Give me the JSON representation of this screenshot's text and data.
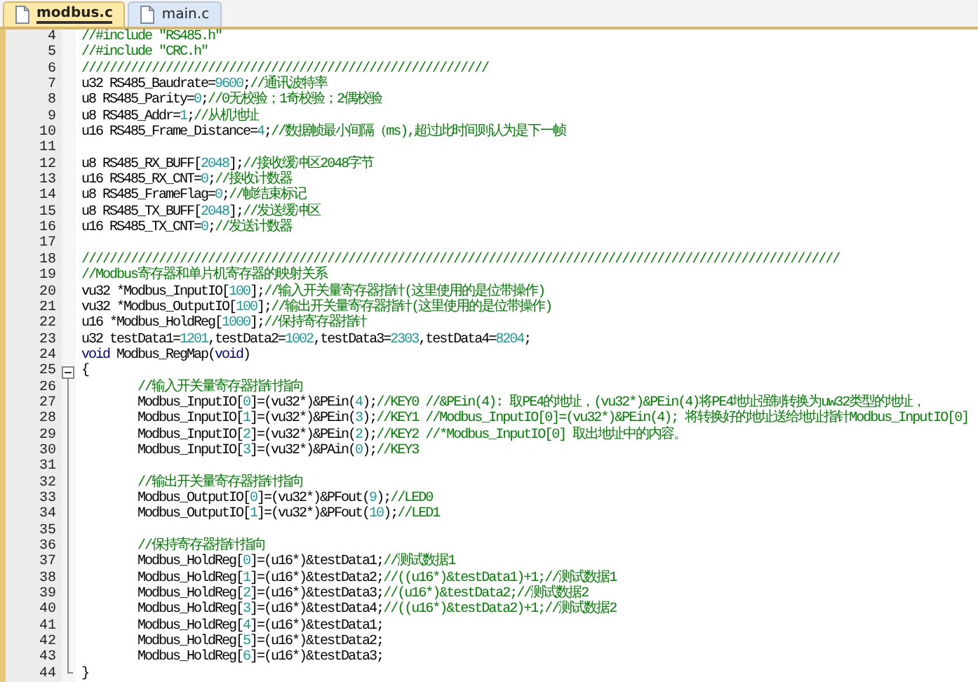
{
  "tabs": [
    {
      "label": "modbus.c",
      "selected": true
    },
    {
      "label": "main.c",
      "selected": false
    }
  ],
  "lines": [
    {
      "number": "4",
      "segments": [
        {
          "kind": "comment",
          "text": "//#include \"RS485.h\""
        }
      ]
    },
    {
      "number": "5",
      "segments": [
        {
          "kind": "comment",
          "text": "//#include \"CRC.h\""
        }
      ]
    },
    {
      "number": "6",
      "segments": [
        {
          "kind": "comment",
          "text": "//////////////////////////////////////////////////////////"
        }
      ]
    },
    {
      "number": "7",
      "segments": [
        {
          "kind": "code",
          "text": "u32 RS485_Baudrate="
        },
        {
          "kind": "number",
          "text": "9600"
        },
        {
          "kind": "code",
          "text": ";"
        },
        {
          "kind": "comment",
          "text": "//通讯波特率"
        }
      ]
    },
    {
      "number": "8",
      "segments": [
        {
          "kind": "code",
          "text": "u8 RS485_Parity="
        },
        {
          "kind": "number",
          "text": "0"
        },
        {
          "kind": "code",
          "text": ";"
        },
        {
          "kind": "comment",
          "text": "//0无校验；1奇校验；2偶校验"
        }
      ]
    },
    {
      "number": "9",
      "segments": [
        {
          "kind": "code",
          "text": "u8 RS485_Addr="
        },
        {
          "kind": "number",
          "text": "1"
        },
        {
          "kind": "code",
          "text": ";"
        },
        {
          "kind": "comment",
          "text": "//从机地址"
        }
      ]
    },
    {
      "number": "10",
      "segments": [
        {
          "kind": "code",
          "text": "u16 RS485_Frame_Distance="
        },
        {
          "kind": "number",
          "text": "4"
        },
        {
          "kind": "code",
          "text": ";"
        },
        {
          "kind": "comment",
          "text": "//数据帧最小间隔（ms),超过此时间则认为是下一帧"
        }
      ]
    },
    {
      "number": "11"
    },
    {
      "number": "12",
      "segments": [
        {
          "kind": "code",
          "text": "u8 RS485_RX_BUFF["
        },
        {
          "kind": "number",
          "text": "2048"
        },
        {
          "kind": "code",
          "text": "];"
        },
        {
          "kind": "comment",
          "text": "//接收缓冲区2048字节"
        }
      ]
    },
    {
      "number": "13",
      "segments": [
        {
          "kind": "code",
          "text": "u16 RS485_RX_CNT="
        },
        {
          "kind": "number",
          "text": "0"
        },
        {
          "kind": "code",
          "text": ";"
        },
        {
          "kind": "comment",
          "text": "//接收计数器"
        }
      ]
    },
    {
      "number": "14",
      "segments": [
        {
          "kind": "code",
          "text": "u8 RS485_FrameFlag="
        },
        {
          "kind": "number",
          "text": "0"
        },
        {
          "kind": "code",
          "text": ";"
        },
        {
          "kind": "comment",
          "text": "//帧结束标记"
        }
      ]
    },
    {
      "number": "15",
      "segments": [
        {
          "kind": "code",
          "text": "u8 RS485_TX_BUFF["
        },
        {
          "kind": "number",
          "text": "2048"
        },
        {
          "kind": "code",
          "text": "];"
        },
        {
          "kind": "comment",
          "text": "//发送缓冲区"
        }
      ]
    },
    {
      "number": "16",
      "segments": [
        {
          "kind": "code",
          "text": "u16 RS485_TX_CNT="
        },
        {
          "kind": "number",
          "text": "0"
        },
        {
          "kind": "code",
          "text": ";"
        },
        {
          "kind": "comment",
          "text": "//发送计数器"
        }
      ]
    },
    {
      "number": "17"
    },
    {
      "number": "18",
      "segments": [
        {
          "kind": "comment",
          "text": "////////////////////////////////////////////////////////////////////////////////////////////////////////////"
        }
      ]
    },
    {
      "number": "19",
      "segments": [
        {
          "kind": "comment",
          "text": "//Modbus寄存器和单片机寄存器的映射关系"
        }
      ]
    },
    {
      "number": "20",
      "segments": [
        {
          "kind": "code",
          "text": "vu32 *Modbus_InputIO["
        },
        {
          "kind": "number",
          "text": "100"
        },
        {
          "kind": "code",
          "text": "];"
        },
        {
          "kind": "comment",
          "text": "//输入开关量寄存器指针(这里使用的是位带操作)"
        }
      ]
    },
    {
      "number": "21",
      "segments": [
        {
          "kind": "code",
          "text": "vu32 *Modbus_OutputIO["
        },
        {
          "kind": "number",
          "text": "100"
        },
        {
          "kind": "code",
          "text": "];"
        },
        {
          "kind": "comment",
          "text": "//输出开关量寄存器指针(这里使用的是位带操作)"
        }
      ]
    },
    {
      "number": "22",
      "segments": [
        {
          "kind": "code",
          "text": "u16 *Modbus_HoldReg["
        },
        {
          "kind": "number",
          "text": "1000"
        },
        {
          "kind": "code",
          "text": "];"
        },
        {
          "kind": "comment",
          "text": "//保持寄存器指针"
        }
      ]
    },
    {
      "number": "23",
      "segments": [
        {
          "kind": "code",
          "text": "u32 testData1="
        },
        {
          "kind": "number",
          "text": "1201"
        },
        {
          "kind": "code",
          "text": ",testData2="
        },
        {
          "kind": "number",
          "text": "1002"
        },
        {
          "kind": "code",
          "text": ",testData3="
        },
        {
          "kind": "number",
          "text": "2303"
        },
        {
          "kind": "code",
          "text": ",testData4="
        },
        {
          "kind": "number",
          "text": "8204"
        },
        {
          "kind": "code",
          "text": ";"
        }
      ]
    },
    {
      "number": "24",
      "segments": [
        {
          "kind": "keyword",
          "text": "void"
        },
        {
          "kind": "code",
          "text": " Modbus_RegMap("
        },
        {
          "kind": "keyword",
          "text": "void"
        },
        {
          "kind": "code",
          "text": ")"
        }
      ]
    },
    {
      "number": "25",
      "segments": [
        {
          "kind": "code",
          "text": "{"
        }
      ],
      "children": [
        {
          "number": "26",
          "segments": [
            {
              "kind": "comment",
              "text": "//输入开关量寄存器指针指向"
            }
          ]
        },
        {
          "number": "27",
          "segments": [
            {
              "kind": "code",
              "text": "Modbus_InputIO["
            },
            {
              "kind": "number",
              "text": "0"
            },
            {
              "kind": "code",
              "text": "]=(vu32*)&PEin("
            },
            {
              "kind": "number",
              "text": "4"
            },
            {
              "kind": "code",
              "text": ");"
            },
            {
              "kind": "comment",
              "text": "//KEY0 //&PEin(4): 取PE4的地址，(vu32*)&PEin(4)将PE4地址强制转换为uw32类型的地址，"
            }
          ]
        },
        {
          "number": "28",
          "segments": [
            {
              "kind": "code",
              "text": "Modbus_InputIO["
            },
            {
              "kind": "number",
              "text": "1"
            },
            {
              "kind": "code",
              "text": "]=(vu32*)&PEin("
            },
            {
              "kind": "number",
              "text": "3"
            },
            {
              "kind": "code",
              "text": ");"
            },
            {
              "kind": "comment",
              "text": "//KEY1 //Modbus_InputIO[0]=(vu32*)&PEin(4); 将转换好的地址送给地址指针Modbus_InputIO[0]"
            }
          ]
        },
        {
          "number": "29",
          "segments": [
            {
              "kind": "code",
              "text": "Modbus_InputIO["
            },
            {
              "kind": "number",
              "text": "2"
            },
            {
              "kind": "code",
              "text": "]=(vu32*)&PEin("
            },
            {
              "kind": "number",
              "text": "2"
            },
            {
              "kind": "code",
              "text": ");"
            },
            {
              "kind": "comment",
              "text": "//KEY2 //*Modbus_InputIO[0] 取出地址中的内容。"
            }
          ]
        },
        {
          "number": "30",
          "segments": [
            {
              "kind": "code",
              "text": "Modbus_InputIO["
            },
            {
              "kind": "number",
              "text": "3"
            },
            {
              "kind": "code",
              "text": "]=(vu32*)&PAin("
            },
            {
              "kind": "number",
              "text": "0"
            },
            {
              "kind": "code",
              "text": ");"
            },
            {
              "kind": "comment",
              "text": "//KEY3"
            }
          ]
        },
        {
          "number": "31"
        },
        {
          "number": "32",
          "segments": [
            {
              "kind": "comment",
              "text": "//输出开关量寄存器指针指向"
            }
          ]
        },
        {
          "number": "33",
          "segments": [
            {
              "kind": "code",
              "text": "Modbus_OutputIO["
            },
            {
              "kind": "number",
              "text": "0"
            },
            {
              "kind": "code",
              "text": "]=(vu32*)&PFout("
            },
            {
              "kind": "number",
              "text": "9"
            },
            {
              "kind": "code",
              "text": ");"
            },
            {
              "kind": "comment",
              "text": "//LED0"
            }
          ]
        },
        {
          "number": "34",
          "segments": [
            {
              "kind": "code",
              "text": "Modbus_OutputIO["
            },
            {
              "kind": "number",
              "text": "1"
            },
            {
              "kind": "code",
              "text": "]=(vu32*)&PFout("
            },
            {
              "kind": "number",
              "text": "10"
            },
            {
              "kind": "code",
              "text": ");"
            },
            {
              "kind": "comment",
              "text": "//LED1"
            }
          ]
        },
        {
          "number": "35"
        },
        {
          "number": "36",
          "segments": [
            {
              "kind": "comment",
              "text": "//保持寄存器指针指向"
            }
          ]
        },
        {
          "number": "37",
          "segments": [
            {
              "kind": "code",
              "text": "Modbus_HoldReg["
            },
            {
              "kind": "number",
              "text": "0"
            },
            {
              "kind": "code",
              "text": "]=(u16*)&testData1;"
            },
            {
              "kind": "comment",
              "text": "//测试数据1"
            }
          ]
        },
        {
          "number": "38",
          "segments": [
            {
              "kind": "code",
              "text": "Modbus_HoldReg["
            },
            {
              "kind": "number",
              "text": "1"
            },
            {
              "kind": "code",
              "text": "]=(u16*)&testData2;"
            },
            {
              "kind": "comment",
              "text": "//((u16*)&testData1)+1;//测试数据1"
            }
          ]
        },
        {
          "number": "39",
          "segments": [
            {
              "kind": "code",
              "text": "Modbus_HoldReg["
            },
            {
              "kind": "number",
              "text": "2"
            },
            {
              "kind": "code",
              "text": "]=(u16*)&testData3;"
            },
            {
              "kind": "comment",
              "text": "//(u16*)&testData2;//测试数据2"
            }
          ]
        },
        {
          "number": "40",
          "segments": [
            {
              "kind": "code",
              "text": "Modbus_HoldReg["
            },
            {
              "kind": "number",
              "text": "3"
            },
            {
              "kind": "code",
              "text": "]=(u16*)&testData4;"
            },
            {
              "kind": "comment",
              "text": "//((u16*)&testData2)+1;//测试数据2"
            }
          ]
        },
        {
          "number": "41",
          "segments": [
            {
              "kind": "code",
              "text": "Modbus_HoldReg["
            },
            {
              "kind": "number",
              "text": "4"
            },
            {
              "kind": "code",
              "text": "]=(u16*)&testData1;"
            }
          ]
        },
        {
          "number": "42",
          "segments": [
            {
              "kind": "code",
              "text": "Modbus_HoldReg["
            },
            {
              "kind": "number",
              "text": "5"
            },
            {
              "kind": "code",
              "text": "]=(u16*)&testData2;"
            }
          ]
        },
        {
          "number": "43",
          "segments": [
            {
              "kind": "code",
              "text": "Modbus_HoldReg["
            },
            {
              "kind": "number",
              "text": "6"
            },
            {
              "kind": "code",
              "text": "]=(u16*)&testData3;"
            }
          ]
        }
      ]
    },
    {
      "number": "44",
      "segments": [
        {
          "kind": "code",
          "text": "}"
        }
      ]
    }
  ]
}
